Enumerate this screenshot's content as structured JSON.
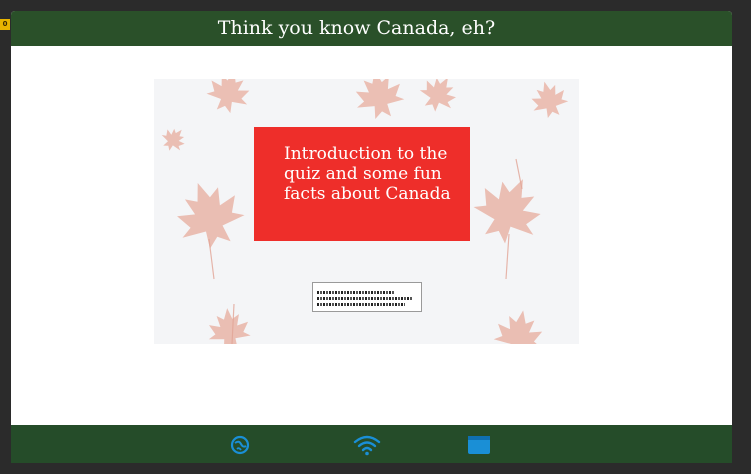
{
  "window": {
    "title": "Think you know Canada, eh?"
  },
  "badge": {
    "text": "0"
  },
  "slide": {
    "heading": "Introduction to the quiz and some fun facts about Canada",
    "background_motif": "maple-leaf-pattern",
    "box_color": "#ee2e2a"
  },
  "toolbar": {
    "icons": [
      "globe-icon",
      "wifi-icon",
      "window-icon"
    ],
    "icon_color": "#1a8fd6"
  },
  "colors": {
    "titlebar": "#2a5029",
    "bottombar": "#254c29",
    "accent": "#ee2e2a"
  }
}
